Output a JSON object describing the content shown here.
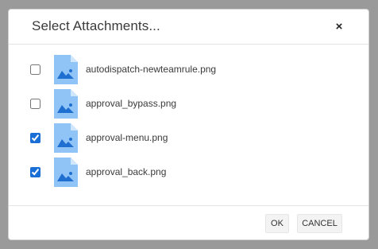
{
  "dialog": {
    "title": "Select Attachments...",
    "close_label": "×"
  },
  "files": [
    {
      "name": "autodispatch-newteamrule.png",
      "checked": false,
      "icon": "image-file-icon"
    },
    {
      "name": "approval_bypass.png",
      "checked": false,
      "icon": "image-file-icon"
    },
    {
      "name": "approval-menu.png",
      "checked": true,
      "icon": "image-file-icon"
    },
    {
      "name": "approval_back.png",
      "checked": true,
      "icon": "image-file-icon"
    }
  ],
  "buttons": {
    "ok_label": "OK",
    "cancel_label": "CANCEL"
  },
  "colors": {
    "icon_fill": "#90c4f7",
    "icon_fold": "#cfe6fc",
    "icon_glyph": "#1f6fd1",
    "checkbox_accent": "#1a6fd6"
  }
}
